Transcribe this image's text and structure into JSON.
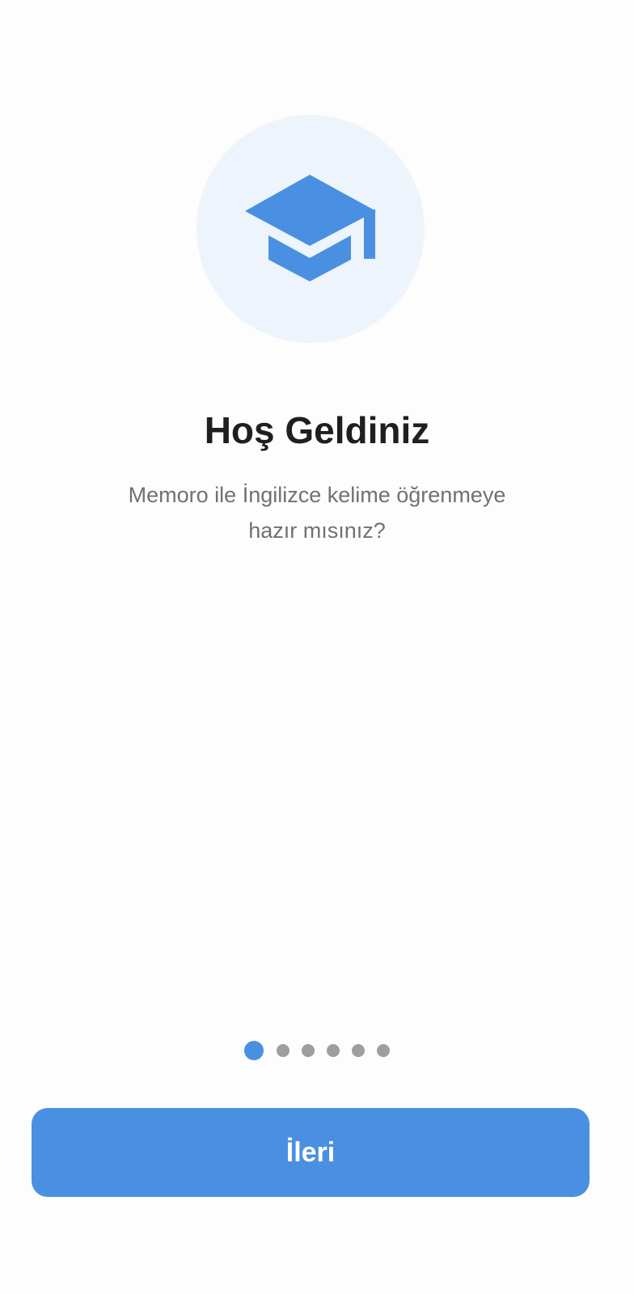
{
  "hero": {
    "icon": "graduation-cap-icon",
    "icon_color": "#4a90e2",
    "circle_color": "#eef4fb"
  },
  "onboarding": {
    "title": "Hoş Geldiniz",
    "subtitle": "Memoro ile İngilizce kelime öğrenmeye hazır mısınız?"
  },
  "pagination": {
    "total_pages": 6,
    "current_page": 1,
    "active_color": "#4a90e2",
    "inactive_color": "#9e9e9e"
  },
  "actions": {
    "next_label": "İleri",
    "button_color": "#4a90e2"
  }
}
